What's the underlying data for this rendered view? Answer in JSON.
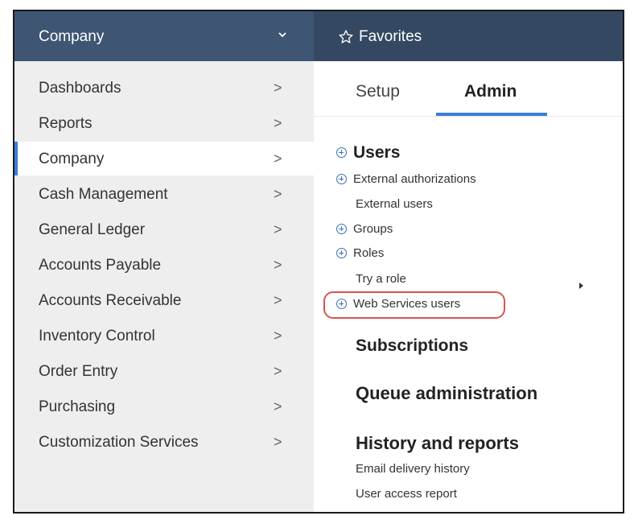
{
  "topbar": {
    "company_label": "Company",
    "favorites_label": "Favorites"
  },
  "sidebar": {
    "items": [
      {
        "label": "Dashboards",
        "arrow": ">"
      },
      {
        "label": "Reports",
        "arrow": ">"
      },
      {
        "label": "Company",
        "arrow": ">",
        "active": true
      },
      {
        "label": "Cash Management",
        "arrow": ">"
      },
      {
        "label": "General Ledger",
        "arrow": ">"
      },
      {
        "label": "Accounts Payable",
        "arrow": ">"
      },
      {
        "label": "Accounts Receivable",
        "arrow": ">"
      },
      {
        "label": "Inventory Control",
        "arrow": ">"
      },
      {
        "label": "Order Entry",
        "arrow": ">"
      },
      {
        "label": "Purchasing",
        "arrow": ">"
      },
      {
        "label": "Customization Services",
        "arrow": ">"
      }
    ]
  },
  "main": {
    "tabs": [
      {
        "label": "Setup"
      },
      {
        "label": "Admin",
        "active": true
      }
    ],
    "users_heading": "Users",
    "users_links": {
      "external_authorizations": "External authorizations",
      "external_users": "External users",
      "groups": "Groups",
      "roles": "Roles",
      "try_a_role": "Try a role",
      "web_services_users": "Web Services users"
    },
    "subscriptions_heading": "Subscriptions",
    "queue_heading": "Queue administration",
    "history_heading": "History and reports",
    "history_links": {
      "email_delivery_history": "Email delivery history",
      "user_access_report": "User access report"
    }
  },
  "colors": {
    "topbar": "#344862",
    "company_menu": "#3f5574",
    "sidebar_bg": "#eeeeee",
    "accent_blue": "#3b7dd8",
    "highlight_red": "#d9534f"
  }
}
